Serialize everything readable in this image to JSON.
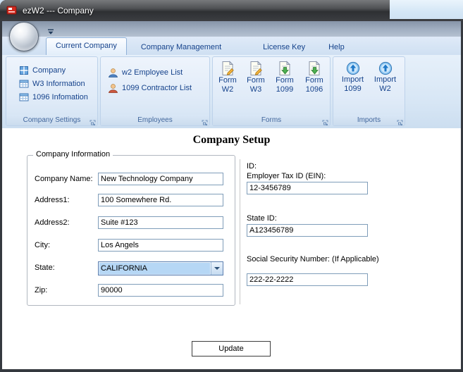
{
  "window": {
    "title": "ezW2 --- Company"
  },
  "ribbon": {
    "tabs": [
      {
        "label": "Current Company",
        "active": true
      },
      {
        "label": "Company Management",
        "active": false
      },
      {
        "label": "License Key",
        "active": false
      },
      {
        "label": "Help",
        "active": false
      }
    ],
    "groups": [
      {
        "caption": "Company Settings",
        "items": [
          {
            "label": "Company",
            "icon": "company-icon"
          },
          {
            "label": "W3 Information",
            "icon": "table-icon"
          },
          {
            "label": "1096 Infomation",
            "icon": "table-icon"
          }
        ]
      },
      {
        "caption": "Employees",
        "items": [
          {
            "label": "w2 Employee List",
            "icon": "employee-person-icon"
          },
          {
            "label": "1099 Contractor List",
            "icon": "contractor-person-icon"
          }
        ]
      },
      {
        "caption": "Forms",
        "items": [
          {
            "line1": "Form",
            "line2": "W2",
            "icon": "form-edit-icon"
          },
          {
            "line1": "Form",
            "line2": "W3",
            "icon": "form-edit-icon"
          },
          {
            "line1": "Form",
            "line2": "1099",
            "icon": "form-export-icon"
          },
          {
            "line1": "Form",
            "line2": "1096",
            "icon": "form-export-icon"
          }
        ]
      },
      {
        "caption": "Imports",
        "items": [
          {
            "line1": "Import",
            "line2": "1099",
            "icon": "import-icon"
          },
          {
            "line1": "Import",
            "line2": "W2",
            "icon": "import-icon"
          }
        ]
      }
    ]
  },
  "main": {
    "heading": "Company Setup",
    "company_info": {
      "legend": "Company Information",
      "fields": [
        {
          "label": "Company Name:",
          "value": "New Technology Company"
        },
        {
          "label": "Address1:",
          "value": "100 Somewhere Rd."
        },
        {
          "label": "Address2:",
          "value": "Suite #123"
        },
        {
          "label": "City:",
          "value": "Los Angels"
        },
        {
          "label": "State:",
          "value": "CALIFORNIA",
          "control": "combobox"
        },
        {
          "label": "Zip:",
          "value": "90000"
        }
      ]
    },
    "id_section": {
      "title": "ID:",
      "fields": [
        {
          "label": "Employer Tax ID (EIN):",
          "value": "12-3456789"
        },
        {
          "label": "State ID:",
          "value": "A123456789"
        },
        {
          "label": "Social Security Number: (If Applicable)",
          "value": "222-22-2222"
        }
      ]
    },
    "update_button": "Update"
  },
  "colors": {
    "ribbon_text": "#15428b",
    "ribbon_background": "#d8e6f5",
    "titlebar_background": "#3a3e42",
    "selection_highlight": "#b6d7f5",
    "app_icon_red": "#d42a1e"
  }
}
